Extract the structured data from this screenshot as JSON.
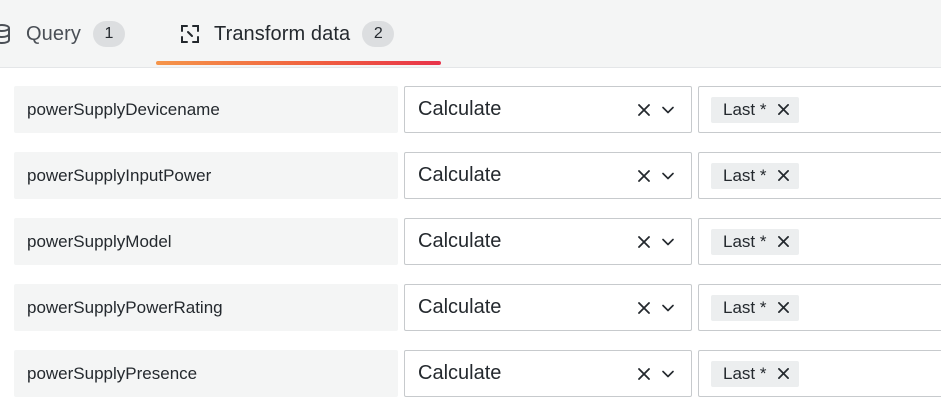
{
  "tabs": [
    {
      "label": "Query",
      "count": "1",
      "icon": "database-icon"
    },
    {
      "label": "Transform data",
      "count": "2",
      "icon": "transform-icon"
    }
  ],
  "active_tab": "Transform data",
  "colors": {
    "tab_underline_start": "#f5954a",
    "tab_underline_end": "#e8334a"
  },
  "rows": [
    {
      "field": "powerSupplyDevicename",
      "mode": "Calculate",
      "reducer": "Last *"
    },
    {
      "field": "powerSupplyInputPower",
      "mode": "Calculate",
      "reducer": "Last *"
    },
    {
      "field": "powerSupplyModel",
      "mode": "Calculate",
      "reducer": "Last *"
    },
    {
      "field": "powerSupplyPowerRating",
      "mode": "Calculate",
      "reducer": "Last *"
    },
    {
      "field": "powerSupplyPresence",
      "mode": "Calculate",
      "reducer": "Last *"
    }
  ]
}
